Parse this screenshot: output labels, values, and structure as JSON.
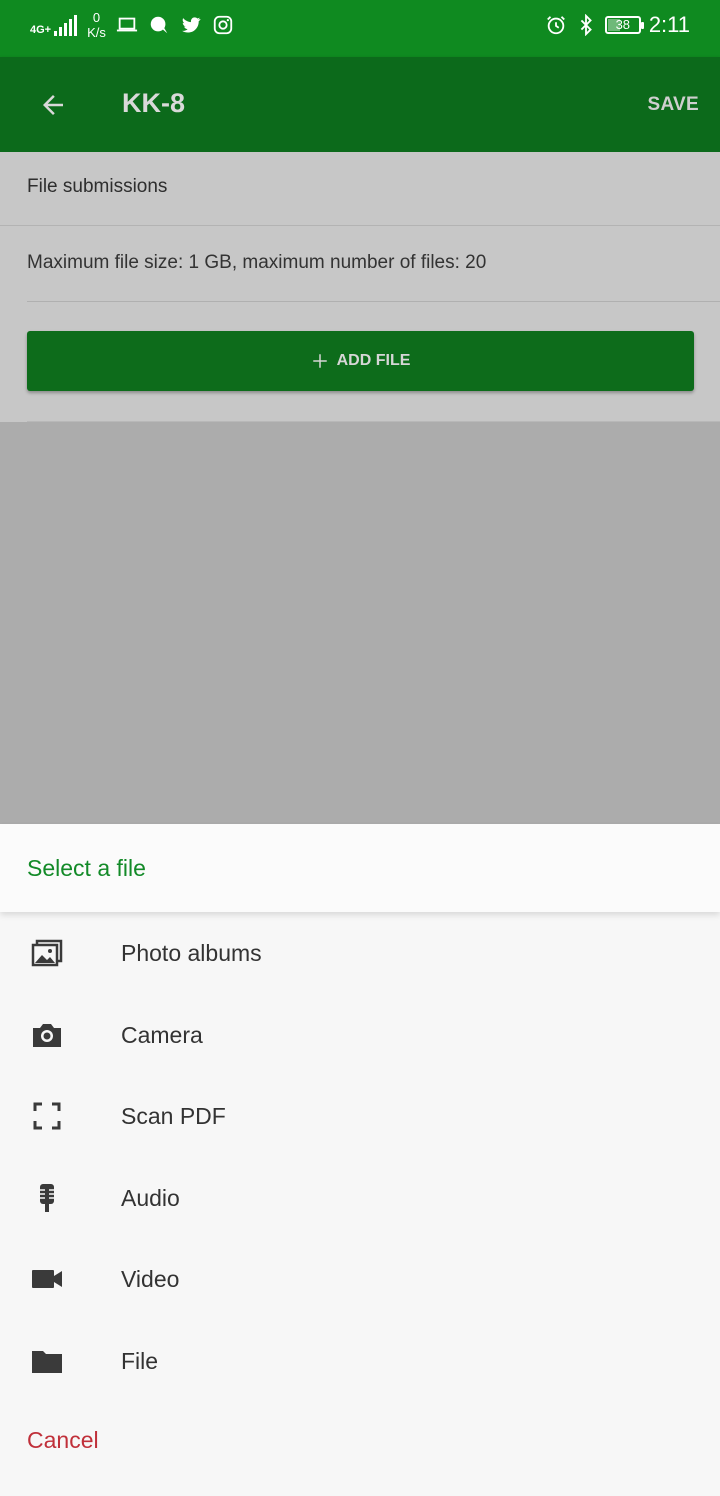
{
  "status_bar": {
    "network_type": "4G+",
    "speed_value": "0",
    "speed_unit": "K/s",
    "battery": "38",
    "time": "2:11",
    "icons": [
      "signal-icon",
      "laptop-icon",
      "chat-icon",
      "twitter-icon",
      "instagram-icon",
      "alarm-icon",
      "bluetooth-icon",
      "battery-icon"
    ]
  },
  "app_bar": {
    "title": "KK-8",
    "save_label": "SAVE"
  },
  "content": {
    "section_title": "File submissions",
    "limit_text": "Maximum file size: 1 GB, maximum number of files: 20",
    "add_file_label": "ADD FILE"
  },
  "sheet": {
    "title": "Select a file",
    "options": [
      {
        "label": "Photo albums",
        "icon": "photo-albums-icon"
      },
      {
        "label": "Camera",
        "icon": "camera-icon"
      },
      {
        "label": "Scan PDF",
        "icon": "scan-icon"
      },
      {
        "label": "Audio",
        "icon": "microphone-icon"
      },
      {
        "label": "Video",
        "icon": "video-camera-icon"
      },
      {
        "label": "File",
        "icon": "folder-icon"
      }
    ],
    "cancel_label": "Cancel"
  },
  "colors": {
    "status_bar": "#0f8a20",
    "app_bar": "#0c6a1b",
    "accent": "#138a28",
    "cancel": "#c0303a"
  }
}
